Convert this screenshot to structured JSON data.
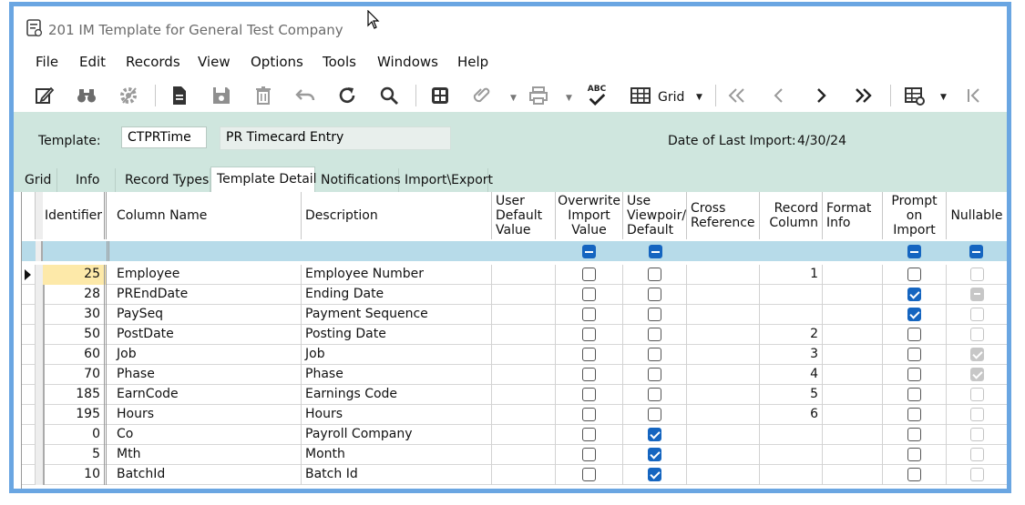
{
  "window": {
    "title": "201 IM Template for General Test Company"
  },
  "menu": [
    "File",
    "Edit",
    "Records",
    "View",
    "Options",
    "Tools",
    "Windows",
    "Help"
  ],
  "toolbar": {
    "icons": [
      "edit-icon",
      "binoculars-icon",
      "settings-icon",
      "new-document-icon",
      "save-icon",
      "delete-icon",
      "undo-icon",
      "refresh-icon",
      "search-icon",
      "calculator-icon",
      "attachment-icon",
      "print-icon",
      "spellcheck-icon",
      "grid-icon",
      "first-record-icon",
      "previous-record-icon",
      "next-record-icon",
      "last-record-icon",
      "grid-settings-icon",
      "collapse-icon"
    ],
    "grid_label": "Grid",
    "spellcheck_text": "ABC"
  },
  "header": {
    "template_label": "Template:",
    "template_value": "CTPRTime",
    "template_desc": "PR Timecard Entry",
    "last_import_label": "Date of Last Import:",
    "last_import_value": "4/30/24"
  },
  "tabs": [
    "Grid",
    "Info",
    "Record Types",
    "Template Detail",
    "Notifications",
    "Import\\Export"
  ],
  "active_tab": "Template Detail",
  "grid": {
    "columns": [
      "Identifier",
      "Column Name",
      "Description",
      "User Default Value",
      "Overwrite Import Value",
      "Use Viewpoir/ Default",
      "Cross Reference",
      "Record Column",
      "Format Info",
      "Prompt on Import",
      "Nullable"
    ],
    "rows": [
      {
        "id": "25",
        "name": "Employee",
        "desc": "Employee Number",
        "overwrite": false,
        "use_vp": false,
        "rec_col": "1",
        "prompt": false,
        "nullable": "off"
      },
      {
        "id": "28",
        "name": "PREndDate",
        "desc": "Ending Date",
        "overwrite": false,
        "use_vp": false,
        "rec_col": "",
        "prompt": true,
        "nullable": "indeterminate"
      },
      {
        "id": "30",
        "name": "PaySeq",
        "desc": "Payment Sequence",
        "overwrite": false,
        "use_vp": false,
        "rec_col": "",
        "prompt": true,
        "nullable": "off"
      },
      {
        "id": "50",
        "name": "PostDate",
        "desc": "Posting Date",
        "overwrite": false,
        "use_vp": false,
        "rec_col": "2",
        "prompt": false,
        "nullable": "off"
      },
      {
        "id": "60",
        "name": "Job",
        "desc": "Job",
        "overwrite": false,
        "use_vp": false,
        "rec_col": "3",
        "prompt": false,
        "nullable": "checked"
      },
      {
        "id": "70",
        "name": "Phase",
        "desc": "Phase",
        "overwrite": false,
        "use_vp": false,
        "rec_col": "4",
        "prompt": false,
        "nullable": "checked"
      },
      {
        "id": "185",
        "name": "EarnCode",
        "desc": "Earnings Code",
        "overwrite": false,
        "use_vp": false,
        "rec_col": "5",
        "prompt": false,
        "nullable": "off"
      },
      {
        "id": "195",
        "name": "Hours",
        "desc": "Hours",
        "overwrite": false,
        "use_vp": false,
        "rec_col": "6",
        "prompt": false,
        "nullable": "off"
      },
      {
        "id": "0",
        "name": "Co",
        "desc": "Payroll Company",
        "overwrite": false,
        "use_vp": true,
        "rec_col": "",
        "prompt": false,
        "nullable": "off"
      },
      {
        "id": "5",
        "name": "Mth",
        "desc": "Month",
        "overwrite": false,
        "use_vp": true,
        "rec_col": "",
        "prompt": false,
        "nullable": "off"
      },
      {
        "id": "10",
        "name": "BatchId",
        "desc": "Batch Id",
        "overwrite": false,
        "use_vp": true,
        "rec_col": "",
        "prompt": false,
        "nullable": "off"
      }
    ]
  },
  "colors": {
    "accent": "#1565c0",
    "panel": "#cfe6de",
    "filter": "#b7dbe9",
    "selected_id": "#fde9a9",
    "frame": "#6aa6e2"
  }
}
